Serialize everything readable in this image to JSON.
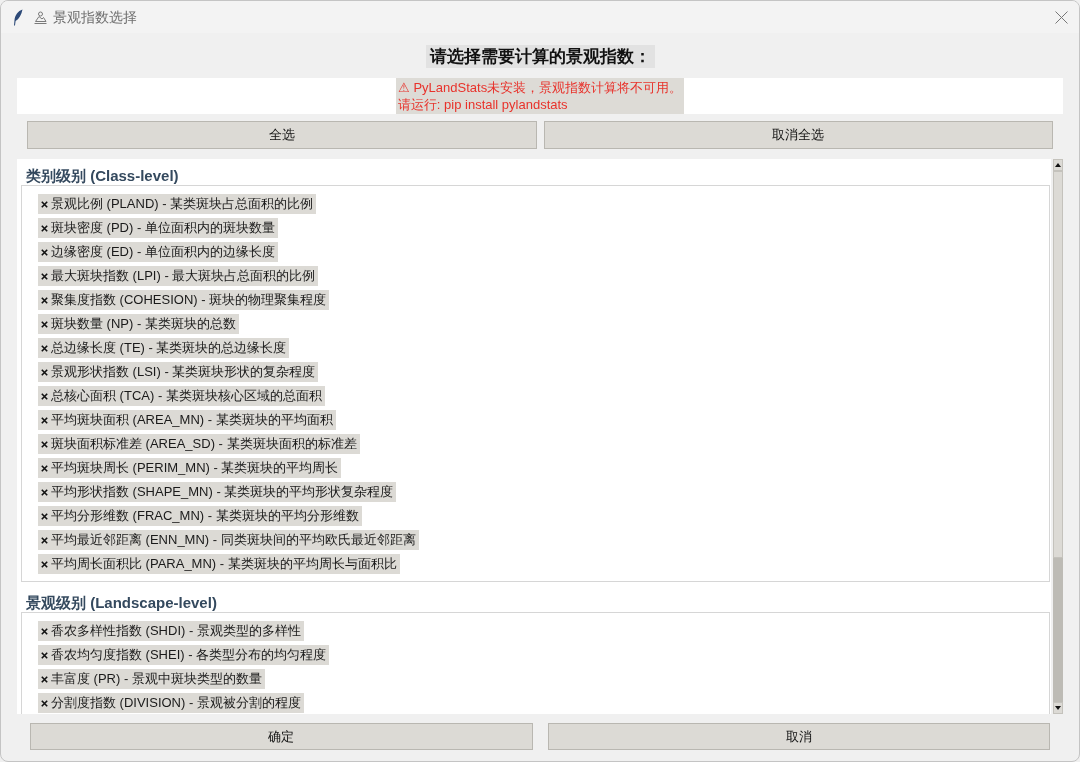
{
  "window": {
    "title": "景观指数选择"
  },
  "heading": "请选择需要计算的景观指数：",
  "warning": {
    "lines": [
      "⚠ PyLandStats未安装，景观指数计算将不可用。",
      "请运行: pip install pylandstats"
    ]
  },
  "selection_buttons": [
    "全选",
    "取消全选"
  ],
  "sections": [
    {
      "title": "类别级别 (Class-level)",
      "items": [
        {
          "label": "景观比例 (PLAND) - 某类斑块占总面积的比例",
          "checked": true
        },
        {
          "label": "斑块密度 (PD) - 单位面积内的斑块数量",
          "checked": true
        },
        {
          "label": "边缘密度 (ED) - 单位面积内的边缘长度",
          "checked": true
        },
        {
          "label": "最大斑块指数 (LPI) - 最大斑块占总面积的比例",
          "checked": true
        },
        {
          "label": "聚集度指数 (COHESION) - 斑块的物理聚集程度",
          "checked": true
        },
        {
          "label": "斑块数量 (NP) - 某类斑块的总数",
          "checked": true
        },
        {
          "label": "总边缘长度 (TE) - 某类斑块的总边缘长度",
          "checked": true
        },
        {
          "label": "景观形状指数 (LSI) - 某类斑块形状的复杂程度",
          "checked": true
        },
        {
          "label": "总核心面积 (TCA) - 某类斑块核心区域的总面积",
          "checked": true
        },
        {
          "label": "平均斑块面积 (AREA_MN) - 某类斑块的平均面积",
          "checked": true
        },
        {
          "label": "斑块面积标准差 (AREA_SD) - 某类斑块面积的标准差",
          "checked": true
        },
        {
          "label": "平均斑块周长 (PERIM_MN) - 某类斑块的平均周长",
          "checked": true
        },
        {
          "label": "平均形状指数 (SHAPE_MN) - 某类斑块的平均形状复杂程度",
          "checked": true
        },
        {
          "label": "平均分形维数 (FRAC_MN) - 某类斑块的平均分形维数",
          "checked": true
        },
        {
          "label": "平均最近邻距离 (ENN_MN) - 同类斑块间的平均欧氏最近邻距离",
          "checked": true
        },
        {
          "label": "平均周长面积比 (PARA_MN) - 某类斑块的平均周长与面积比",
          "checked": true
        }
      ]
    },
    {
      "title": "景观级别 (Landscape-level)",
      "items": [
        {
          "label": "香农多样性指数 (SHDI) - 景观类型的多样性",
          "checked": true
        },
        {
          "label": "香农均匀度指数 (SHEI) - 各类型分布的均匀程度",
          "checked": true
        },
        {
          "label": "丰富度 (PR) - 景观中斑块类型的数量",
          "checked": true
        },
        {
          "label": "分割度指数 (DIVISION) - 景观被分割的程度",
          "checked": true
        }
      ]
    }
  ],
  "dialog_buttons": [
    "确定",
    "取消"
  ]
}
